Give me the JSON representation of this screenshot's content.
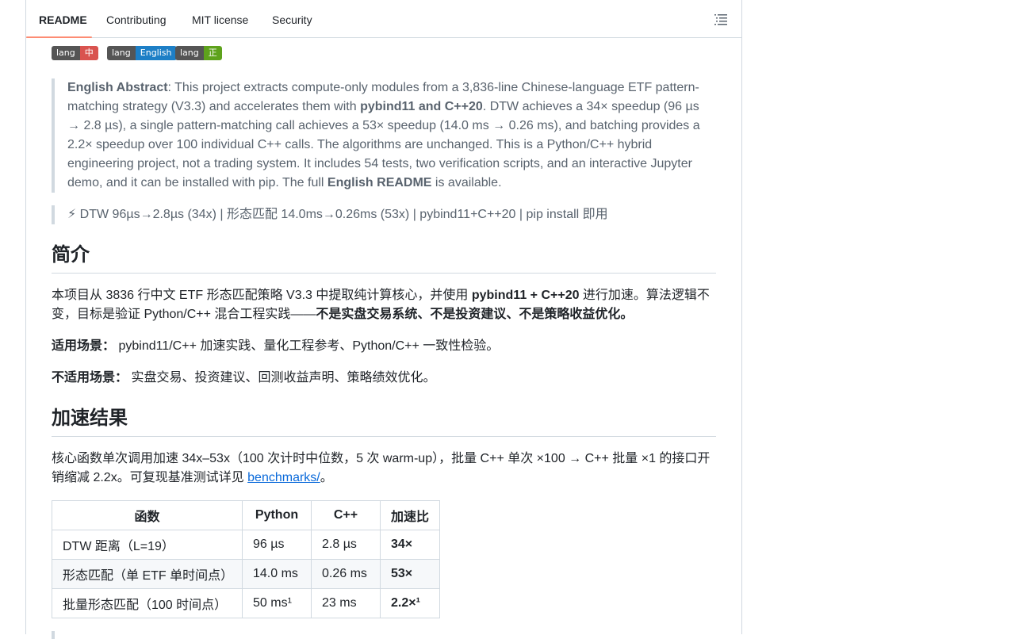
{
  "tabs": [
    {
      "label": "README"
    },
    {
      "label": "Contributing"
    },
    {
      "label": "MIT license"
    },
    {
      "label": "Security"
    }
  ],
  "outline_icon": "list-outline-icon",
  "badges": [
    {
      "left": "lang",
      "right": "中文",
      "color": "#d9534f"
    },
    {
      "left": "lang",
      "right": "English",
      "color": "#1d7fc6"
    },
    {
      "left": "lang",
      "right": "正體中文",
      "color": "#5ea21c"
    }
  ],
  "abstract": {
    "lead_bold": "English Abstract",
    "part1": ": This project extracts compute-only modules from a 3,836-line Chinese-language ETF pattern-matching strategy (V3.3) and accelerates them with ",
    "bold2": "pybind11 and C++20",
    "part2": ". DTW achieves a 34× speedup (96 µs → 2.8 µs), a single pattern-matching call achieves a 53× speedup (14.0 ms → 0.26 ms), and batching provides a 2.2× speedup over 100 individual C++ calls. The algorithms are unchanged. This is a Python/C++ hybrid engineering project, not a trading system. It includes 54 tests, two verification scripts, and an interactive Jupyter demo, and it can be installed with pip. The full ",
    "bold3": "English README",
    "part3": " is available."
  },
  "summary_line": "⚡ DTW 96µs→2.8µs (34x) | 形态匹配 14.0ms→0.26ms (53x) | pybind11+C++20 | pip install 即用",
  "intro": {
    "heading": "简介",
    "p1_a": "本项目从 3836 行中文 ETF 形态匹配策略 V3.3 中提取纯计算核心，并使用 ",
    "p1_b": "pybind11 + C++20",
    "p1_c": " 进行加速。算法逻辑不变，目标是验证 Python/C++ 混合工程实践——",
    "p1_d": "不是实盘交易系统、不是投资建议、不是策略收益优化。",
    "fit_label": "适用场景：",
    "fit_text": " pybind11/C++ 加速实践、量化工程参考、Python/C++ 一致性检验。",
    "unfit_label": "不适用场景：",
    "unfit_text": " 实盘交易、投资建议、回测收益声明、策略绩效优化。"
  },
  "results": {
    "heading": "加速结果",
    "p_a": "核心函数单次调用加速 34x–53x（100 次计时中位数，5 次 warm-up），批量 C++ 单次 ×100 → C++ 批量 ×1 的接口开销缩减 2.2x。可复现基准测试详见 ",
    "link": "benchmarks/",
    "p_c": "。",
    "table": {
      "headers": [
        "函数",
        "Python",
        "C++",
        "加速比"
      ],
      "rows": [
        [
          "DTW 距离（L=19）",
          "96 µs",
          "2.8 µs",
          "34×"
        ],
        [
          "形态匹配（单 ETF 单时间点）",
          "14.0 ms",
          "0.26 ms",
          "53×"
        ],
        [
          "批量形态匹配（100 时间点）",
          "50 ms¹",
          "23 ms",
          "2.2×¹"
        ]
      ]
    }
  }
}
